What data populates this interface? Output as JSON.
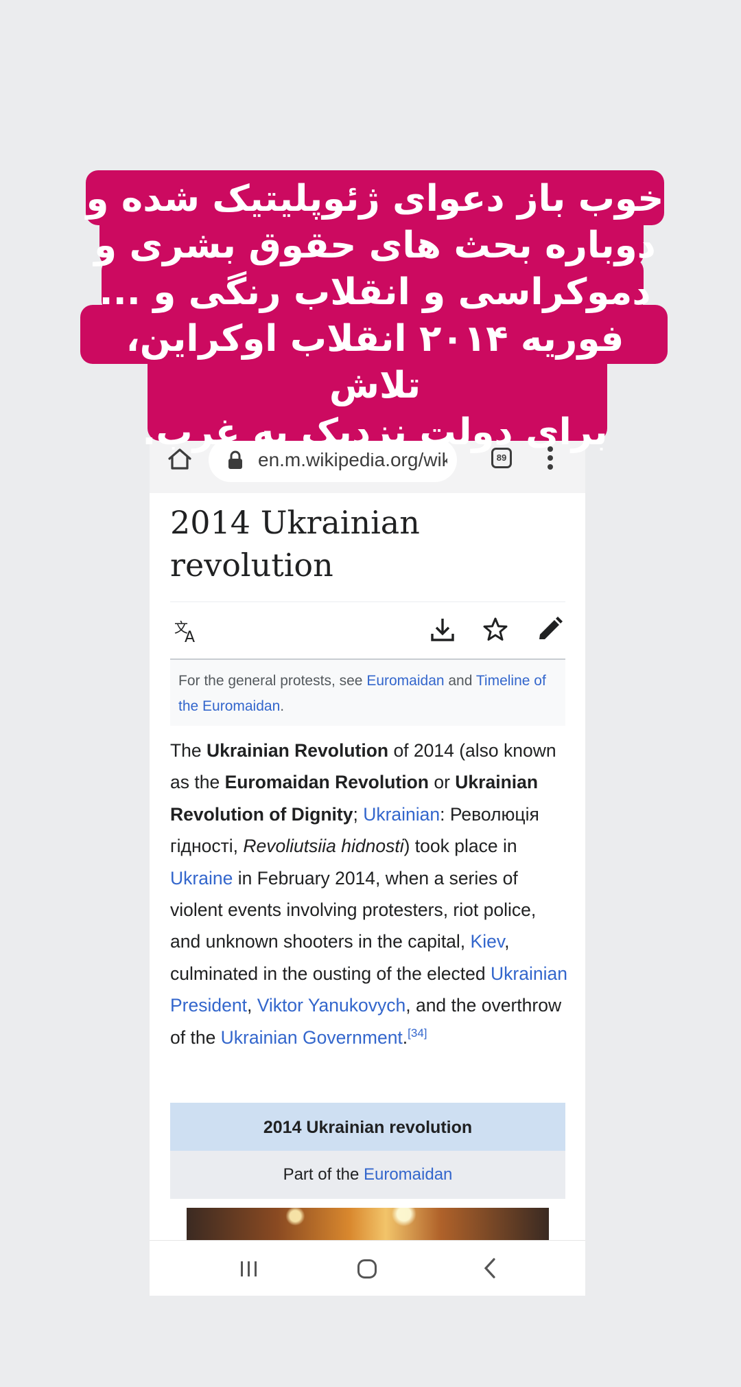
{
  "caption": {
    "lines": [
      "خوب باز دعوای ژئوپلیتیک شده و",
      "دوباره بحث های حقوق بشری و",
      "دموکراسی و انقلاب رنگی و ...",
      "فوریه ۲۰۱۴ انقلاب اوکراین، تلاش",
      "برای دولت نزدیک به غرب."
    ],
    "background_color": "#cc0a60"
  },
  "browser": {
    "home_icon": "home-icon",
    "url": "en.m.wikipedia.org/wik",
    "tab_count": "89",
    "menu_icon": "more-vert-icon"
  },
  "article": {
    "title_line1": "2014 Ukrainian",
    "title_line2": "revolution",
    "actions": {
      "language_icon": "translate-icon",
      "download_icon": "download-icon",
      "watch_icon": "star-icon",
      "edit_icon": "pencil-icon"
    },
    "hatnote": {
      "prefix": "For the general protests, see ",
      "link1": "Euromaidan",
      "middle": " and ",
      "link2": "Timeline of the Euromaidan",
      "suffix": "."
    },
    "paragraph": {
      "t1": "The ",
      "b1": "Ukrainian Revolution",
      "t2": " of 2014 (also known as the ",
      "b2": "Euromaidan Revolution",
      "t3": " or ",
      "b3": "Ukrainian Revolution of Dignity",
      "t4": "; ",
      "l1": "Ukrainian",
      "t5": ": Революція гідності, ",
      "i1": "Revoliutsiia hidnosti",
      "t6": ") took place in ",
      "l2": "Ukraine",
      "t7": " in February 2014, when a series of violent events involving protesters, riot police, and unknown shooters in the capital, ",
      "l3": "Kiev",
      "t8": ", culminated in the ousting of the elected ",
      "l4": "Ukrainian President",
      "t9": ", ",
      "l5": "Viktor Yanukovych",
      "t10": ", and the overthrow of the ",
      "l6": "Ukrainian Government",
      "t11": ".",
      "ref": "[34]"
    },
    "infobox": {
      "title": "2014 Ukrainian revolution",
      "sub_prefix": "Part of the ",
      "sub_link": "Euromaidan"
    }
  },
  "navbar": {
    "recent_icon": "recent-apps-icon",
    "home_icon": "home-circle-icon",
    "back_icon": "back-chevron-icon"
  }
}
